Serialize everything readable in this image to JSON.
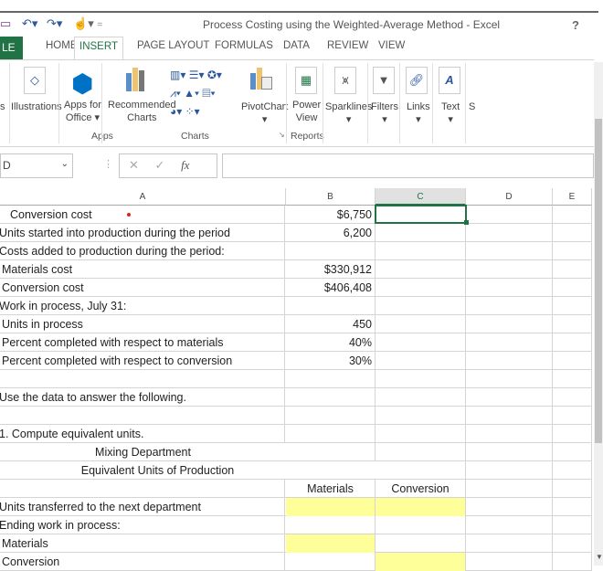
{
  "window": {
    "title": "Process Costing using the Weighted-Average Method - Excel",
    "help": "?"
  },
  "tabs": [
    {
      "label": "LE"
    },
    {
      "label": "HOME"
    },
    {
      "label": "INSERT"
    },
    {
      "label": "PAGE LAYOUT"
    },
    {
      "label": "FORMULAS"
    },
    {
      "label": "DATA"
    },
    {
      "label": "REVIEW"
    },
    {
      "label": "VIEW"
    }
  ],
  "ribbon": {
    "buttons": {
      "tables": "s",
      "illustrations": "Illustrations",
      "apps1": "Apps for",
      "apps2": "Office",
      "rec1": "Recommended",
      "rec2": "Charts",
      "pivot": "PivotChart",
      "power1": "Power",
      "power2": "View",
      "sparklines": "Sparklines",
      "filters": "Filters",
      "links": "Links",
      "text": "Text",
      "more": "S"
    },
    "groups": {
      "apps": "Apps",
      "charts": "Charts",
      "reports": "Reports"
    }
  },
  "formula_bar": {
    "name_box": "D",
    "fx": "fx",
    "value": ""
  },
  "columns": [
    "A",
    "B",
    "C",
    "D",
    "E"
  ],
  "rows": [
    {
      "a": "  Conversion cost",
      "b": "$6,750",
      "c": ""
    },
    {
      "a": "Units started into production during the period",
      "b": "6,200",
      "c": ""
    },
    {
      "a": "Costs added to production during the period:",
      "b": "",
      "c": ""
    },
    {
      "a": "  Materials cost",
      "b": "$330,912",
      "c": ""
    },
    {
      "a": "  Conversion cost",
      "b": "$406,408",
      "c": ""
    },
    {
      "a": "Work in process, July 31:",
      "b": "",
      "c": ""
    },
    {
      "a": "  Units in process",
      "b": "450",
      "c": ""
    },
    {
      "a": "  Percent completed with respect to materials",
      "b": "40%",
      "c": ""
    },
    {
      "a": "  Percent completed with respect to conversion",
      "b": "30%",
      "c": ""
    },
    {
      "a": "",
      "b": "",
      "c": ""
    },
    {
      "a": "Use the data to answer the following.",
      "b": "",
      "c": ""
    },
    {
      "a": "",
      "b": "",
      "c": ""
    },
    {
      "a": "1. Compute equivalent units.",
      "b": "",
      "c": ""
    }
  ],
  "report": {
    "title": "Mixing Department",
    "subtitle": "Equivalent Units of Production",
    "col_materials": "Materials",
    "col_conversion": "Conversion",
    "lines": [
      "Units transferred to the next department",
      "Ending work in process:",
      "  Materials",
      "  Conversion"
    ]
  },
  "colors": {
    "accent": "#217346",
    "input": "#ffff99"
  }
}
